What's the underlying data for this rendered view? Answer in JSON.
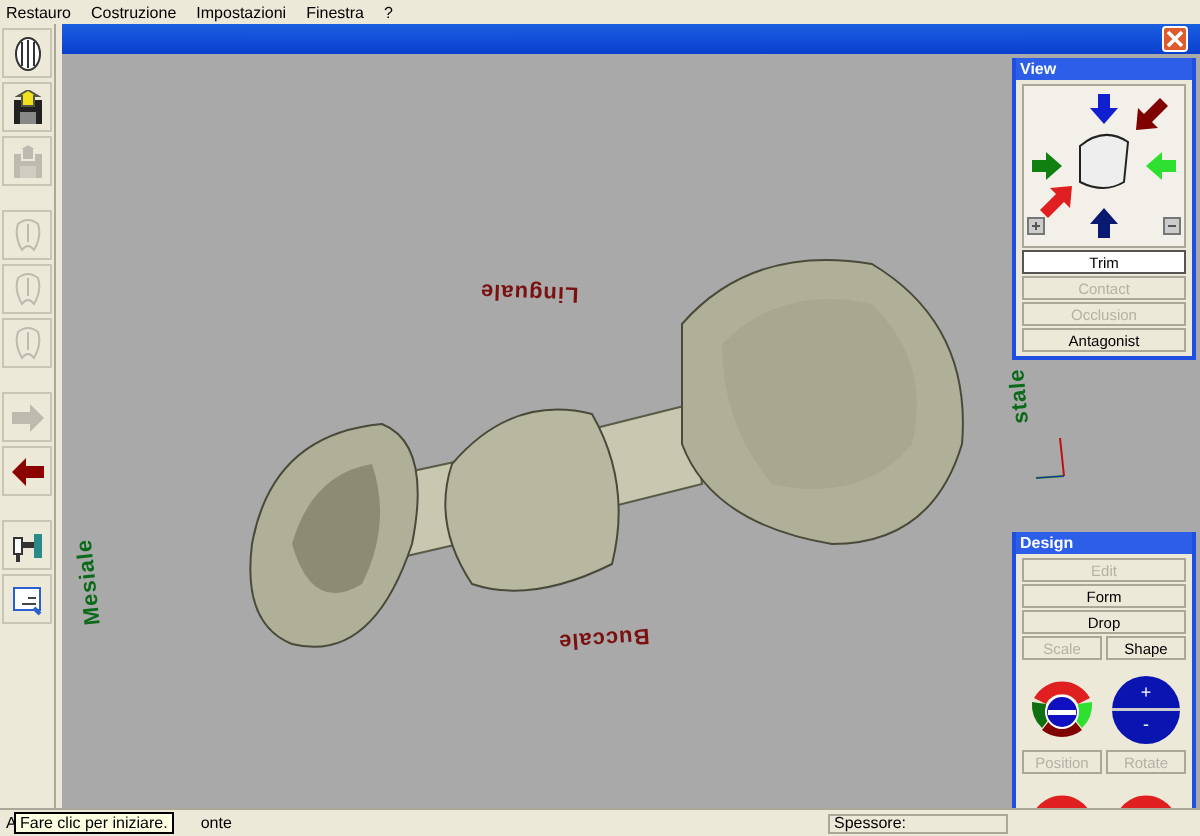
{
  "menu": [
    "Restauro",
    "Costruzione",
    "Impostazioni",
    "Finestra",
    "?"
  ],
  "toolbar": [
    {
      "kind": "teeth",
      "disabled": false
    },
    {
      "kind": "save",
      "disabled": false
    },
    {
      "kind": "save",
      "disabled": true
    },
    {
      "kind": "tooth",
      "disabled": true
    },
    {
      "kind": "tooth",
      "disabled": true
    },
    {
      "kind": "tooth",
      "disabled": true
    },
    {
      "kind": "arrow-right",
      "disabled": true
    },
    {
      "kind": "arrow-left",
      "disabled": false
    },
    {
      "kind": "tool",
      "disabled": false
    },
    {
      "kind": "document",
      "disabled": false
    }
  ],
  "viewport": {
    "labels": [
      {
        "text": "Linguale",
        "kind": "upside"
      },
      {
        "text": "Buccale",
        "kind": "upside"
      },
      {
        "text": "Mesiale",
        "kind": "side"
      },
      {
        "text": "stale",
        "kind": "side-right"
      }
    ]
  },
  "view_panel": {
    "title": "View",
    "buttons": [
      {
        "label": "Trim",
        "selected": true,
        "disabled": false
      },
      {
        "label": "Contact",
        "selected": false,
        "disabled": true
      },
      {
        "label": "Occlusion",
        "selected": false,
        "disabled": true
      },
      {
        "label": "Antagonist",
        "selected": false,
        "disabled": false
      }
    ]
  },
  "design_panel": {
    "title": "Design",
    "buttons": [
      {
        "label": "Edit",
        "disabled": true
      },
      {
        "label": "Form",
        "disabled": false
      },
      {
        "label": "Drop",
        "disabled": false
      }
    ],
    "controls": [
      {
        "label": "Scale",
        "kind": "ring",
        "disabled": true
      },
      {
        "label": "Shape",
        "kind": "plus-minus",
        "disabled": false,
        "plus": "+",
        "minus": "-"
      },
      {
        "label": "Position",
        "kind": "ring",
        "disabled": true
      },
      {
        "label": "Rotate",
        "kind": "ring",
        "disabled": true
      }
    ]
  },
  "status_bar": {
    "text_start": "A",
    "text_end": "onte",
    "thickness_label": "Spessore:"
  },
  "tooltip": "Fare clic per iniziare."
}
